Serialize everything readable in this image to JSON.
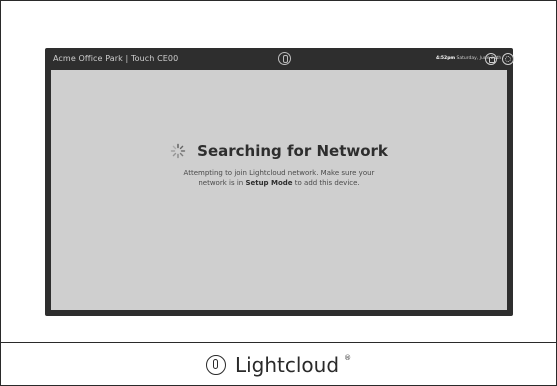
{
  "header": {
    "title": "Acme Office Park | Touch CE00",
    "time": "4:52pm",
    "date": "Saturday, June 24th"
  },
  "status": {
    "heading": "Searching for Network",
    "message_line1": "Attempting to join Lightcloud network. Make sure your",
    "message_line2_prefix": "network is in",
    "message_mode": "Setup Mode",
    "message_line2_suffix": "to add this device."
  },
  "brand": {
    "name": "Lightcloud",
    "trademark": "®"
  },
  "icons": {
    "center_logo": "lightcloud-logo-icon",
    "header_button_1": "screen-icon",
    "header_button_2": "gear-icon",
    "spinner": "loading-spinner-icon"
  }
}
